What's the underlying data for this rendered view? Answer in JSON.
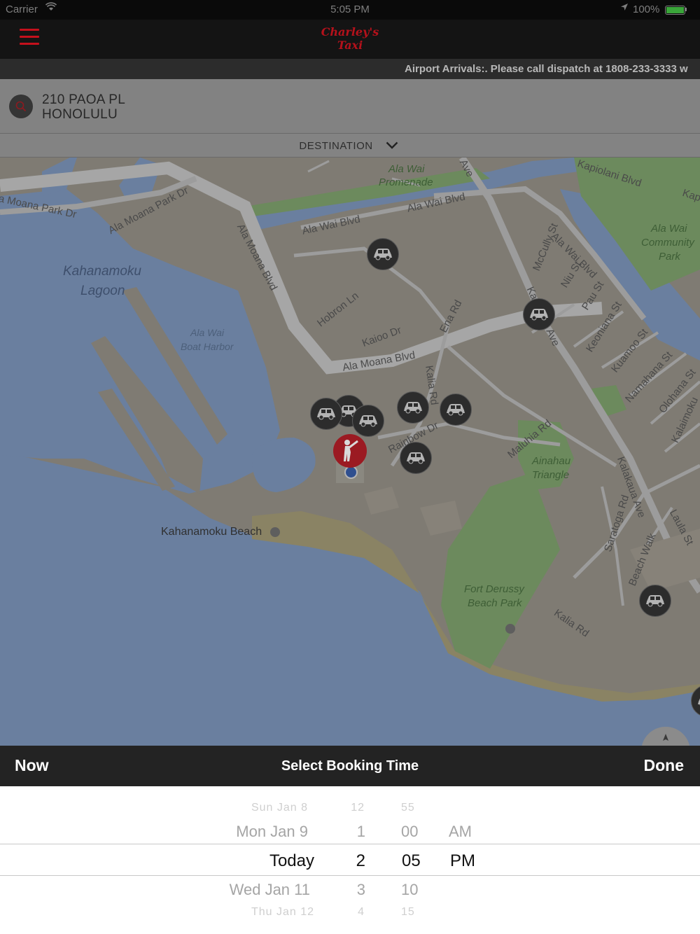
{
  "status_bar": {
    "carrier": "Carrier",
    "time": "5:05 PM",
    "battery": "100%",
    "icons": [
      "wifi-icon",
      "location-arrow-icon",
      "battery-icon"
    ]
  },
  "header": {
    "logo_line1": "Charley's",
    "logo_line2": "Taxi",
    "menu_icon": "hamburger-menu-icon",
    "brand_color": "#b5111b"
  },
  "ticker": {
    "text": "Airport Arrivals:. Please call dispatch at 1808-233-3333 w"
  },
  "pickup": {
    "line1": "210 PAOA PL",
    "line2": "HONOLULU",
    "icon": "search-icon"
  },
  "destination": {
    "label": "DESTINATION",
    "icon": "chevron-down-icon"
  },
  "map": {
    "labels": {
      "moana_park_dr": "a Moana Park Dr",
      "ala_moana_park_dr": "Ala Moana Park Dr",
      "kahanamoku_lagoon_1": "Kahanamoku",
      "kahanamoku_lagoon_2": "Lagoon",
      "boat_harbor_1": "Ala Wai",
      "boat_harbor_2": "Boat Harbor",
      "promenade_1": "Ala Wai",
      "promenade_2": "Promenade",
      "ala_wai_blvd_1": "Ala Wai Blvd",
      "ala_wai_blvd_2": "Ala Wai Blvd",
      "ala_wai_blvd_3": "Ala Wai Blvd",
      "kapiolani_blvd": "Kapiolani Blvd",
      "kap": "Kap",
      "ave": "Ave",
      "ala_moana_blvd_1": "Ala Moana Blvd",
      "ala_moana_blvd_2": "Ala Moana Blvd",
      "hobron_ln": "Hobron Ln",
      "kaioo_dr": "Kaioo Dr",
      "ena_rd": "Ena Rd",
      "kalia_rd_1": "Kalia Rd",
      "kalia_rd_2": "Kalia Rd",
      "rainbow_dr": "Rainbow Dr",
      "mccully_st": "McCully St",
      "niu_st": "Niu St",
      "pau_st": "Pau St",
      "kalakaua_ave_1": "Kalakaua Ave",
      "kalakaua_ave_2": "Kalakaua Ave",
      "keoniana_st": "Keoniana St",
      "kuamoo_st": "Kuamoo St",
      "namahana_st": "Namahana St",
      "olohana_st": "Olohana St",
      "kalaimoku": "Kalaimoku",
      "community_park_1": "Ala Wai",
      "community_park_2": "Community",
      "community_park_3": "Park",
      "maluhia_rd": "Maluhia Rd",
      "ainahau_1": "Ainahau",
      "ainahau_2": "Triangle",
      "saratoga_rd": "Saratoga Rd",
      "beach_walk": "Beach Walk",
      "laulau_st": "Laula St",
      "fort_derussy_1": "Fort Derussy",
      "fort_derussy_2": "Beach Park",
      "kahanamoku_beach": "Kahanamoku Beach"
    },
    "taxi_icon": "taxi-car-icon",
    "pickup_pin_icon": "hailing-person-icon",
    "location_dot": "current-location-dot",
    "control_icon": "compass-icon",
    "colors": {
      "water": "#6a7f9f",
      "land": "#7f7b73",
      "park": "#6c8a5d",
      "road": "#9c9c9c",
      "beach": "#8a8364"
    }
  },
  "booking": {
    "now_label": "Now",
    "title": "Select Booking Time",
    "done_label": "Done",
    "picker": {
      "days": [
        "Sun Jan 8",
        "Mon Jan 9",
        "Today",
        "Wed Jan 11",
        "Thu Jan 12"
      ],
      "hours": [
        "12",
        "1",
        "2",
        "3",
        "4"
      ],
      "minutes": [
        "55",
        "00",
        "05",
        "10",
        "15"
      ],
      "ampm": [
        "AM",
        "PM"
      ],
      "selected": {
        "day": "Today",
        "hour": "2",
        "minute": "05",
        "ampm": "PM"
      }
    }
  }
}
